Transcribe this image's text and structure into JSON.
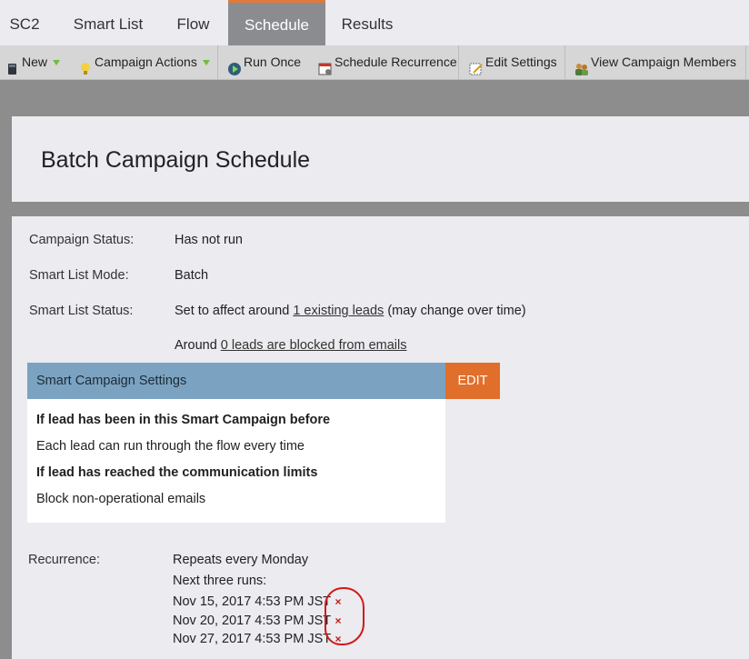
{
  "tabs": [
    {
      "label": "SC2"
    },
    {
      "label": "Smart List"
    },
    {
      "label": "Flow"
    },
    {
      "label": "Schedule",
      "active": true
    },
    {
      "label": "Results"
    }
  ],
  "toolbar": {
    "new_label": "New",
    "campaign_actions_label": "Campaign Actions",
    "run_once_label": "Run Once",
    "schedule_recurrence_label": "Schedule Recurrence",
    "edit_settings_label": "Edit Settings",
    "view_members_label": "View Campaign Members"
  },
  "page": {
    "title": "Batch Campaign Schedule"
  },
  "details": {
    "status_label": "Campaign Status:",
    "status_value": "Has not run",
    "mode_label": "Smart List Mode:",
    "mode_value": "Batch",
    "smartlist_status_label": "Smart List Status:",
    "smartlist_prefix": "Set to affect around",
    "smartlist_link": "1 existing leads",
    "smartlist_suffix": "(may change over time)",
    "blocked_prefix": "Around",
    "blocked_link": "0 leads are blocked from emails"
  },
  "settings": {
    "header": "Smart Campaign Settings",
    "edit_label": "EDIT",
    "q1": "If lead has been in this Smart Campaign before",
    "a1": "Each lead can run through the flow every time",
    "q2": "If lead has reached the communication limits",
    "a2": "Block non-operational emails"
  },
  "recurrence": {
    "label": "Recurrence:",
    "value": "Repeats every Monday",
    "next_label": "Next three runs:",
    "runs": [
      "Nov 15, 2017 4:53 PM JST",
      "Nov 20, 2017 4:53 PM JST",
      "Nov 27, 2017 4:53 PM JST"
    ],
    "delete_glyph": "×"
  },
  "colors": {
    "accent_orange": "#e06f2b",
    "settings_blue": "#7ba3c1",
    "annotation_red": "#d11a1a"
  }
}
